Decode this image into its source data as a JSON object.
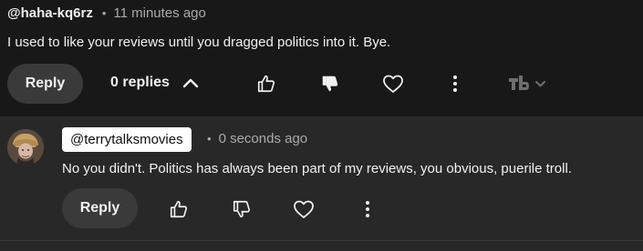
{
  "parent_comment": {
    "author": "@haha-kq6rz",
    "separator": "•",
    "time": "11 minutes ago",
    "text": "I used to like your reviews until you dragged politics into it. Bye.",
    "reply_label": "Reply",
    "replies_label": "0 replies"
  },
  "reply_comment": {
    "author": "@terrytalksmovies",
    "separator": "•",
    "time": "0 seconds ago",
    "text": "No you didn't. Politics has always been part of my reviews, you obvious, puerile troll.",
    "reply_label": "Reply"
  },
  "icons": {
    "like": "thumbs-up-icon",
    "dislike": "thumbs-down-icon",
    "heart": "heart-icon",
    "more": "more-vert-icon",
    "extension": "tubebuddy-logo-icon"
  },
  "colors": {
    "background": "#181818",
    "reply_background": "#282828",
    "pill": "#3a3a3a",
    "secondary_text": "#aaaaaa"
  }
}
